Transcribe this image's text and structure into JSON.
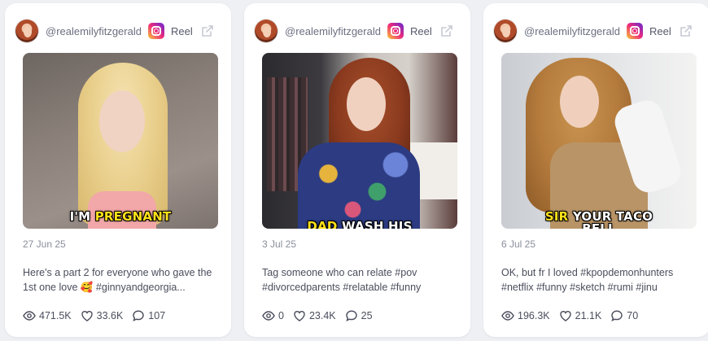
{
  "posts": [
    {
      "handle": "@realemilyfitzgerald",
      "platform_icon": "instagram-icon",
      "type": "Reel",
      "overlay_plain": "I'M ",
      "overlay_highlight": "PREGNANT",
      "date": "27 Jun 25",
      "text": "Here's a part 2 for everyone who gave the 1st one love 🥰 #ginnyandgeorgia...",
      "views": "471.5K",
      "likes": "33.6K",
      "comments": "107"
    },
    {
      "handle": "@realemilyfitzgerald",
      "platform_icon": "instagram-icon",
      "type": "Reel",
      "overlay_plain": "WASH HIS",
      "overlay_highlight": "DAD ",
      "date": "3 Jul 25",
      "text": "Tag someone who can relate #pov #divorcedparents #relatable #funny",
      "views": "0",
      "likes": "23.4K",
      "comments": "25"
    },
    {
      "handle": "@realemilyfitzgerald",
      "platform_icon": "instagram-icon",
      "type": "Reel",
      "overlay_plain": " YOUR TACO",
      "overlay_highlight": "SIR",
      "overlay_line2": "BELL",
      "date": "6 Jul 25",
      "text": "OK, but fr I loved #kpopdemonhunters #netflix #funny #sketch #rumi #jinu",
      "views": "196.3K",
      "likes": "21.1K",
      "comments": "70"
    }
  ],
  "colors": {
    "page_bg": "#eef0f4",
    "card_bg": "#ffffff",
    "caption_highlight": "#ffe11a"
  }
}
